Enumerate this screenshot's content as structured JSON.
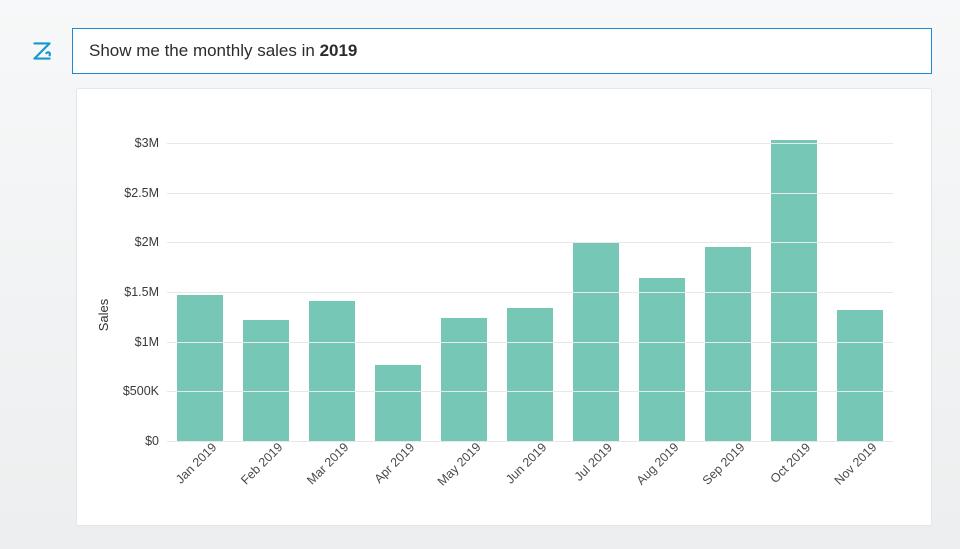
{
  "query": {
    "prefix": "Show me the monthly sales in ",
    "bold": "2019"
  },
  "logo": {
    "name": "zia-logo",
    "color": "#1698cc"
  },
  "chart_data": {
    "type": "bar",
    "title": "",
    "xlabel": "",
    "ylabel": "Sales",
    "ylim": [
      0,
      3200000
    ],
    "y_ticks": [
      {
        "value": 0,
        "label": "$0"
      },
      {
        "value": 500000,
        "label": "$500K"
      },
      {
        "value": 1000000,
        "label": "$1M"
      },
      {
        "value": 1500000,
        "label": "$1.5M"
      },
      {
        "value": 2000000,
        "label": "$2M"
      },
      {
        "value": 2500000,
        "label": "$2.5M"
      },
      {
        "value": 3000000,
        "label": "$3M"
      }
    ],
    "categories": [
      "Jan 2019",
      "Feb 2019",
      "Mar 2019",
      "Apr 2019",
      "May 2019",
      "Jun 2019",
      "Jul 2019",
      "Aug 2019",
      "Sep 2019",
      "Oct 2019",
      "Nov 2019"
    ],
    "values": [
      1470000,
      1220000,
      1410000,
      760000,
      1240000,
      1340000,
      2000000,
      1640000,
      1950000,
      3030000,
      1320000
    ],
    "bar_color": "#77c7b6"
  }
}
